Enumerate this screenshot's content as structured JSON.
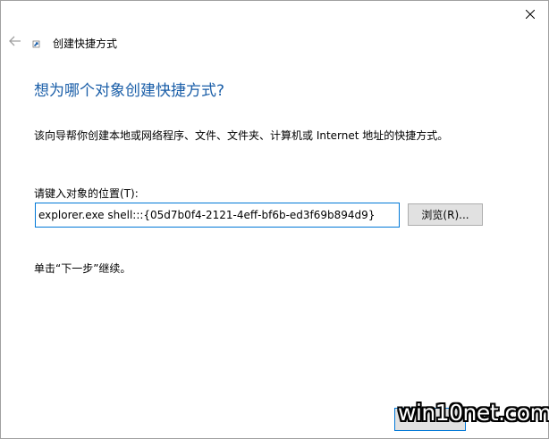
{
  "window": {
    "header_title": "创建快捷方式",
    "close_icon": "close-icon",
    "back_icon": "back-arrow-icon",
    "wizard_icon": "shortcut-wizard-icon"
  },
  "main": {
    "heading": "想为哪个对象创建快捷方式?",
    "description": "该向导帮你创建本地或网络程序、文件、文件夹、计算机或 Internet 地址的快捷方式。",
    "location_label": "请键入对象的位置(T):",
    "location_value": "explorer.exe shell:::{05d7b0f4-2121-4eff-bf6b-ed3f69b894d9}",
    "browse_label": "浏览(R)...",
    "hint": "单击“下一步”继续。"
  },
  "watermark": {
    "text": "win10net.com"
  },
  "colors": {
    "heading": "#1a5ea8",
    "accent_border": "#0078d7",
    "button_bg": "#e1e1e1"
  }
}
